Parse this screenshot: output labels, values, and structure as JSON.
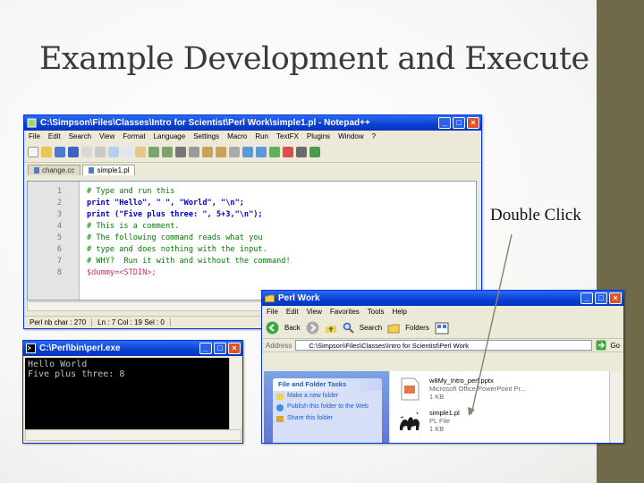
{
  "slide": {
    "title": "Example Development and Execute",
    "callout": "Double Click"
  },
  "colors": {
    "accent_bar": "#6e6a4a",
    "xp_title": "#0a3fd1"
  },
  "notepad": {
    "title": "C:\\Simpson\\Files\\Classes\\Intro for Scientist\\Perl Work\\simple1.pl - Notepad++",
    "menu": [
      "File",
      "Edit",
      "Search",
      "View",
      "Format",
      "Language",
      "Settings",
      "Macro",
      "Run",
      "TextFX",
      "Plugins",
      "Window",
      "?"
    ],
    "tabs": [
      "change.cc",
      "simple1.pl"
    ],
    "lines": [
      {
        "n": "1",
        "text": "# Type and run this",
        "type": "cm"
      },
      {
        "n": "2",
        "text": "print \"Hello\", \" \", \"World\", \"\\n\";",
        "type": "kw"
      },
      {
        "n": "3",
        "text": "print (\"Five plus three: \", 5+3,\"\\n\");",
        "type": "kw"
      },
      {
        "n": "4",
        "text": "# This is a comment.",
        "type": "cm"
      },
      {
        "n": "5",
        "text": "# The following command reads what you",
        "type": "cm"
      },
      {
        "n": "6",
        "text": "# type and does nothing with the input.",
        "type": "cm"
      },
      {
        "n": "7",
        "text": "# WHY?  Run it with and without the command!",
        "type": "cm"
      },
      {
        "n": "8",
        "text": "$dummy=<STDIN>;",
        "type": "var"
      }
    ],
    "status": [
      "Perl  nb char : 270",
      "Ln : 7   Col : 19   Sel : 0"
    ]
  },
  "cmd": {
    "title": "C:\\Perl\\bin\\perl.exe",
    "output": "Hello World\nFive plus three: 8"
  },
  "explorer": {
    "title": "Perl Work",
    "menu": [
      "File",
      "Edit",
      "View",
      "Favorites",
      "Tools",
      "Help"
    ],
    "back_label": "Back",
    "search_label": "Search",
    "folders_label": "Folders",
    "address_label": "Address",
    "address": "C:\\Simpson\\Files\\Classes\\Intro for Scientist\\Perl Work",
    "go_label": "Go",
    "tasks_header": "File and Folder Tasks",
    "tasks": [
      "Make a new folder",
      "Publish this folder to the Web",
      "Share this folder"
    ],
    "files": [
      {
        "name": "w8My_Intro_perl.pptx",
        "type": "Microsoft Office PowerPoint Pr...",
        "size": "1 KB",
        "icon": "powerpoint-file-icon"
      },
      {
        "name": "simple1.pl",
        "type": "PL File",
        "size": "1 KB",
        "icon": "perl-camel-file-icon"
      }
    ]
  }
}
